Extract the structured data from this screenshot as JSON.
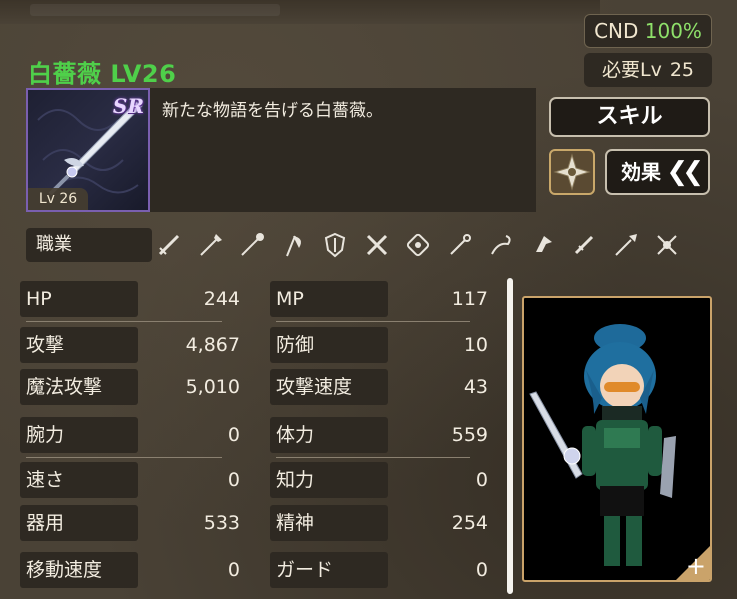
{
  "item": {
    "name": "白薔薇 LV26",
    "rarity": "SR",
    "level_badge": "Lv 26",
    "description": "新たな物語を告げる白薔薇。"
  },
  "condition": {
    "label": "CND",
    "value": "100%"
  },
  "required_level": {
    "label": "必要Lv",
    "value": "25"
  },
  "buttons": {
    "skill": "スキル",
    "effect": "効果",
    "effect_chevron": "❮❮"
  },
  "jobs": {
    "label": "職業",
    "icons": [
      "sword-icon",
      "spear-icon",
      "staff-icon",
      "axe-icon",
      "shield-icon",
      "crossed-daggers-icon",
      "fist-icon",
      "wand-icon",
      "whip-icon",
      "boomerang-icon",
      "dagger-icon",
      "lance-icon",
      "claw-icon"
    ]
  },
  "stats": {
    "left": [
      {
        "label": "HP",
        "value": "244"
      },
      {
        "label": "攻撃",
        "value": "4,867"
      },
      {
        "label": "魔法攻撃",
        "value": "5,010"
      },
      {
        "label": "腕力",
        "value": "0"
      },
      {
        "label": "速さ",
        "value": "0"
      },
      {
        "label": "器用",
        "value": "533"
      },
      {
        "label": "移動速度",
        "value": "0"
      }
    ],
    "right": [
      {
        "label": "MP",
        "value": "117"
      },
      {
        "label": "防御",
        "value": "10"
      },
      {
        "label": "攻撃速度",
        "value": "43"
      },
      {
        "label": "体力",
        "value": "559"
      },
      {
        "label": "知力",
        "value": "0"
      },
      {
        "label": "精神",
        "value": "254"
      },
      {
        "label": "ガード",
        "value": "0"
      }
    ]
  },
  "portrait": {
    "expand": "+"
  },
  "colors": {
    "name_green": "#4fd04a",
    "cnd_green": "#8ee06a",
    "panel": "#2e2922",
    "gold_border": "#caa36a"
  }
}
